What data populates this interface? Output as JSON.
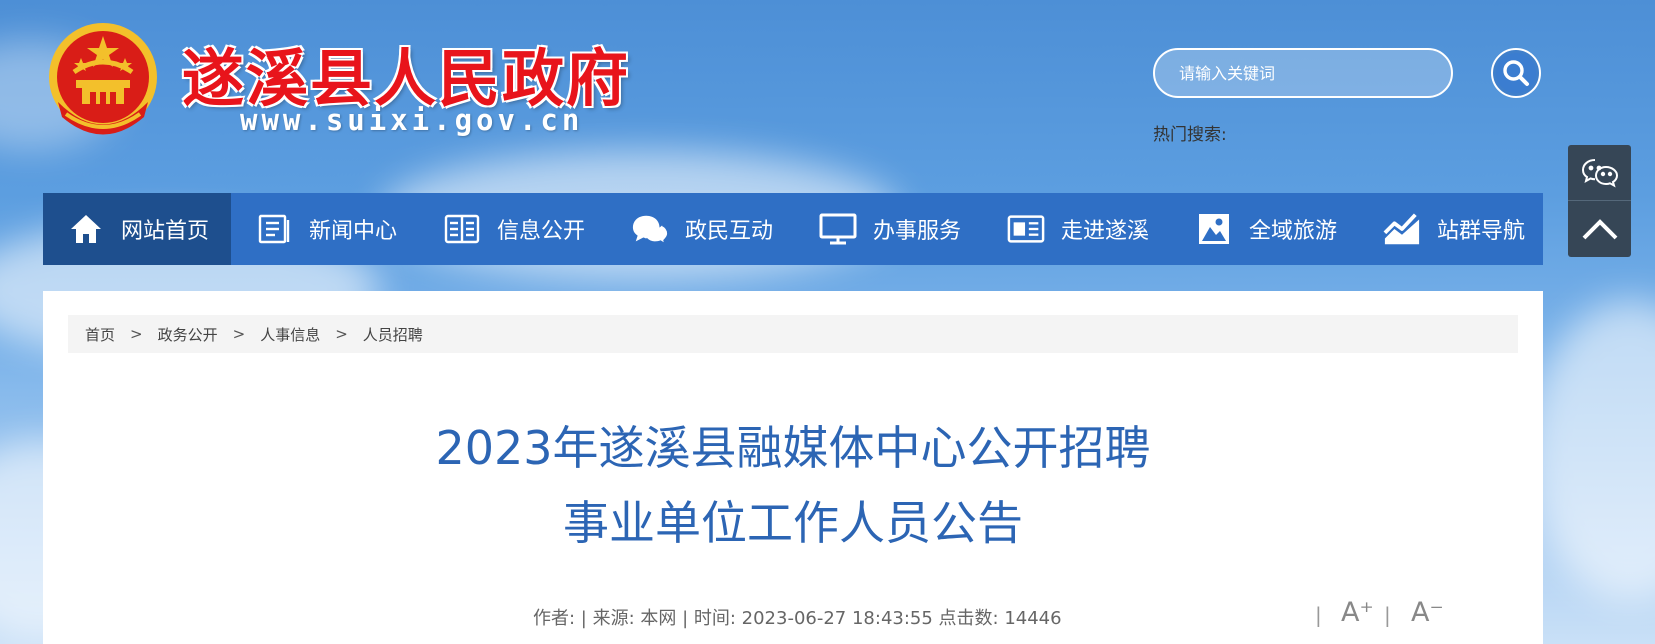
{
  "header": {
    "site_title": "遂溪县人民政府",
    "site_url": "www.suixi.gov.cn",
    "emblem": "national-emblem",
    "search": {
      "placeholder": "请输入关键词",
      "button_icon": "search-icon"
    },
    "hot_search_label": "热门搜索:"
  },
  "nav": {
    "items": [
      {
        "label": "网站首页",
        "icon": "home-icon",
        "active": true
      },
      {
        "label": "新闻中心",
        "icon": "news-icon"
      },
      {
        "label": "信息公开",
        "icon": "book-icon"
      },
      {
        "label": "政民互动",
        "icon": "chat-bubbles-icon"
      },
      {
        "label": "办事服务",
        "icon": "monitor-icon"
      },
      {
        "label": "走进遂溪",
        "icon": "newspaper-icon"
      },
      {
        "label": "全域旅游",
        "icon": "picture-icon"
      },
      {
        "label": "站群导航",
        "icon": "trend-chart-icon"
      }
    ]
  },
  "side_tools": {
    "wechat_icon": "wechat-icon",
    "top_icon": "chevron-up-icon"
  },
  "breadcrumb": {
    "items": [
      "首页",
      "政务公开",
      "人事信息",
      "人员招聘"
    ],
    "separator": ">"
  },
  "article": {
    "title_line1": "2023年遂溪县融媒体中心公开招聘",
    "title_line2": "事业单位工作人员公告",
    "meta": "作者:  | 来源: 本网 | 时间: 2023-06-27 18:43:55 点击数: 14446",
    "font_increase": "A⁺",
    "font_decrease": "A⁻",
    "divider": "|"
  },
  "colors": {
    "nav_bg": "#2f6fc5",
    "nav_active": "#1e4f8e",
    "title_red": "#e8141b",
    "article_title": "#2c65b4"
  }
}
